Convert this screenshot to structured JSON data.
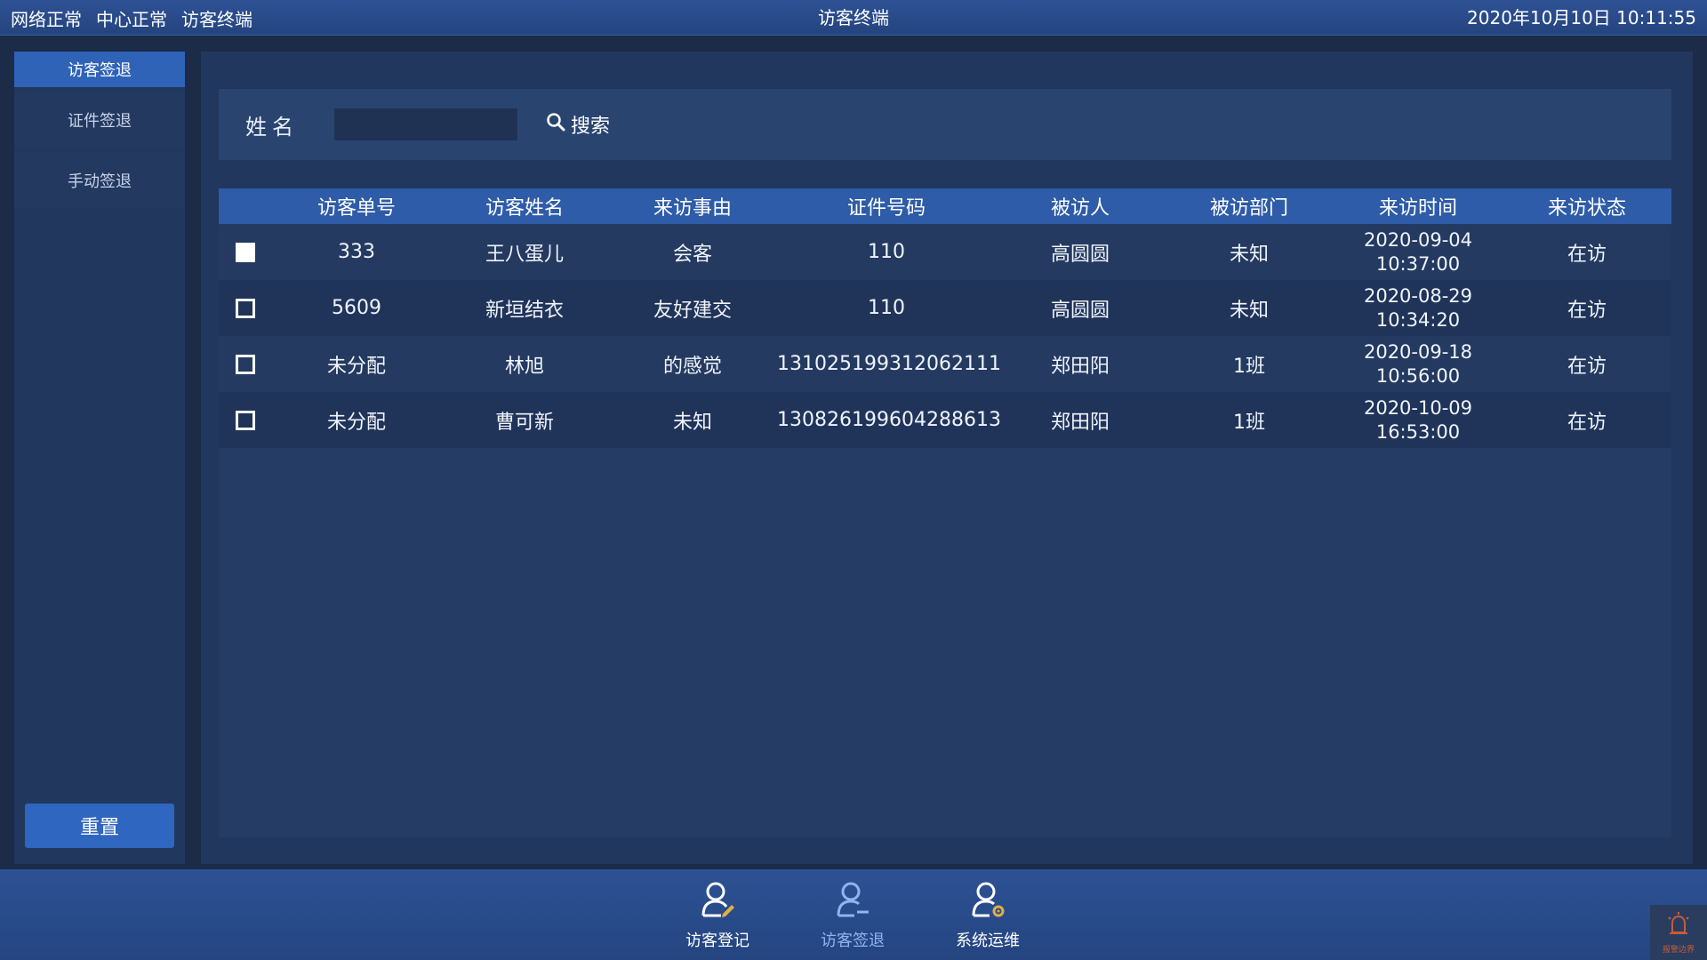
{
  "topbar": {
    "network_status": "网络正常",
    "center_status": "中心正常",
    "terminal_label": "访客终端",
    "title": "访客终端",
    "datetime": "2020年10月10日 10:11:55"
  },
  "sidebar": {
    "items": [
      {
        "label": "访客签退",
        "active": true
      },
      {
        "label": "证件签退",
        "active": false
      },
      {
        "label": "手动签退",
        "active": false
      }
    ],
    "reset_label": "重置"
  },
  "search": {
    "label": "姓名",
    "value": "",
    "placeholder": "",
    "button_label": "搜索"
  },
  "table": {
    "headers": [
      "访客单号",
      "访客姓名",
      "来访事由",
      "证件号码",
      "被访人",
      "被访部门",
      "来访时间",
      "来访状态"
    ],
    "rows": [
      {
        "checked": true,
        "id": "333",
        "name": "王八蛋儿",
        "reason": "会客",
        "cert": "110",
        "host": "高圆圆",
        "dept": "未知",
        "date": "2020-09-04",
        "time": "10:37:00",
        "status": "在访"
      },
      {
        "checked": false,
        "id": "5609",
        "name": "新垣结衣",
        "reason": "友好建交",
        "cert": "110",
        "host": "高圆圆",
        "dept": "未知",
        "date": "2020-08-29",
        "time": "10:34:20",
        "status": "在访"
      },
      {
        "checked": false,
        "id": "未分配",
        "name": "林旭",
        "reason": "的感觉",
        "cert": "131025199312062111",
        "host": "郑田阳",
        "dept": "1班",
        "date": "2020-09-18",
        "time": "10:56:00",
        "status": "在访"
      },
      {
        "checked": false,
        "id": "未分配",
        "name": "曹可新",
        "reason": "未知",
        "cert": "130826199604288613",
        "host": "郑田阳",
        "dept": "1班",
        "date": "2020-10-09",
        "time": "16:53:00",
        "status": "在访"
      }
    ]
  },
  "bottom_nav": {
    "items": [
      {
        "label": "访客登记",
        "icon": "user-edit-icon",
        "active": false
      },
      {
        "label": "访客签退",
        "icon": "user-checkout-icon",
        "active": true
      },
      {
        "label": "系统运维",
        "icon": "user-gear-icon",
        "active": false
      }
    ],
    "corner_label": "报警边界"
  },
  "colors": {
    "accent": "#2f66bf",
    "header_row": "#2e5ca8",
    "active_nav_text": "#8fb4f0",
    "alarm": "#c75b3a"
  }
}
